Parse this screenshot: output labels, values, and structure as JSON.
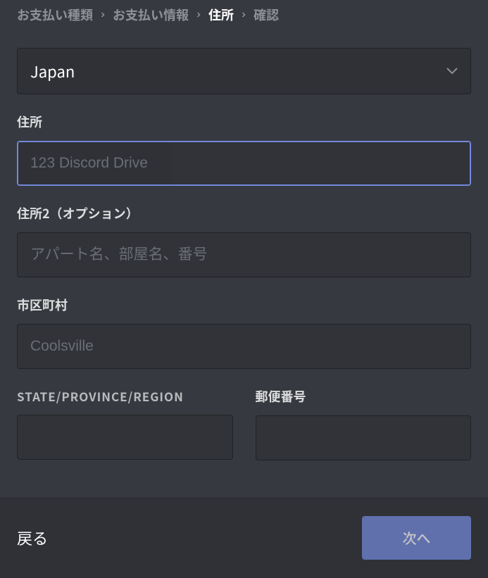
{
  "breadcrumb": {
    "step1": "お支払い種類",
    "step2": "お支払い情報",
    "step3": "住所",
    "step4": "確認"
  },
  "country": {
    "value": "Japan"
  },
  "address1": {
    "label": "住所",
    "placeholder": "123 Discord Drive",
    "value": ""
  },
  "address2": {
    "label": "住所2（オプション）",
    "placeholder": "アパート名、部屋名、番号",
    "value": ""
  },
  "city": {
    "label": "市区町村",
    "placeholder": "Coolsville",
    "value": ""
  },
  "state": {
    "label": "STATE/PROVINCE/REGION",
    "value": ""
  },
  "postal": {
    "label": "郵便番号",
    "value": ""
  },
  "footer": {
    "back": "戻る",
    "next": "次へ"
  }
}
